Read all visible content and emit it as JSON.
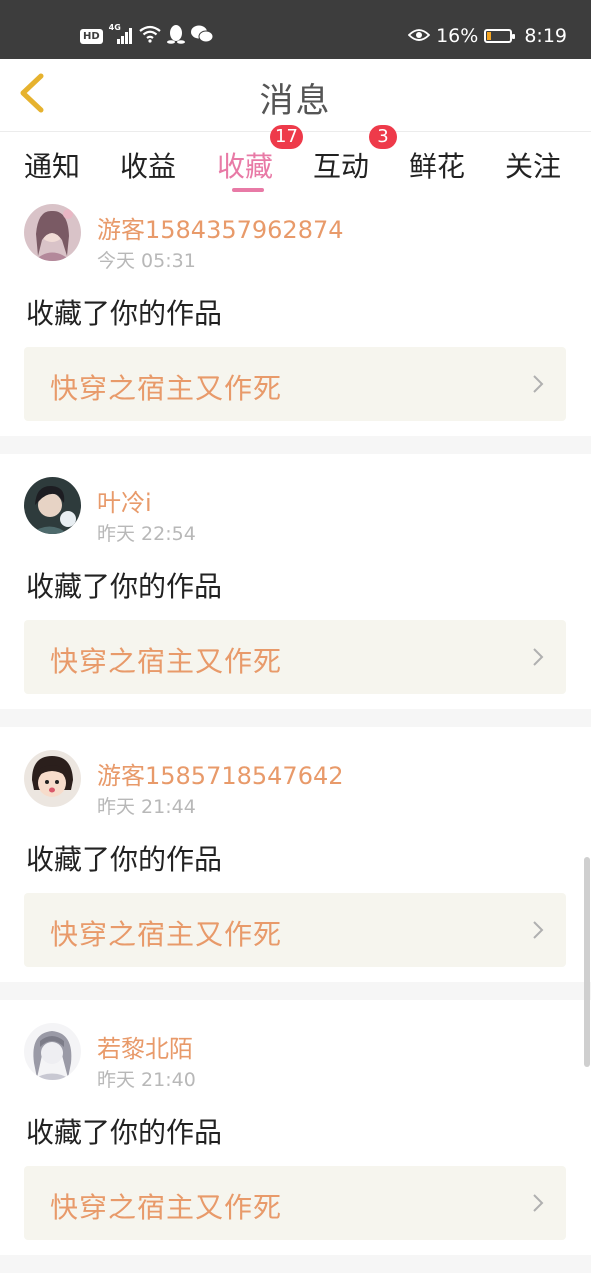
{
  "status_bar": {
    "hd": "HD",
    "network": "4G",
    "battery_percent": "16%",
    "battery_level": 0.16,
    "time": "8:19",
    "icons": [
      "signal-icon",
      "wifi-icon",
      "qq-icon",
      "wechat-icon",
      "eye-icon",
      "battery-icon"
    ]
  },
  "header": {
    "title": "消息",
    "back_icon": "chevron-left-icon",
    "back_color": "#e6b22e"
  },
  "tabs": [
    {
      "label": "通知"
    },
    {
      "label": "收益"
    },
    {
      "label": "收藏",
      "active": true,
      "badge": "17"
    },
    {
      "label": "互动",
      "badge": "3"
    },
    {
      "label": "鲜花"
    },
    {
      "label": "关注"
    }
  ],
  "colors": {
    "accent_pink": "#e87aa6",
    "username_orange": "#e89a6a",
    "badge_red": "#ee3a4a",
    "card_bg": "#f6f5ee"
  },
  "messages": [
    {
      "username": "游客1584357962874",
      "time": "今天 05:31",
      "action": "收藏了你的作品",
      "work": "快穿之宿主又作死"
    },
    {
      "username": "叶冷i",
      "time": "昨天 22:54",
      "action": "收藏了你的作品",
      "work": "快穿之宿主又作死"
    },
    {
      "username": "游客1585718547642",
      "time": "昨天 21:44",
      "action": "收藏了你的作品",
      "work": "快穿之宿主又作死"
    },
    {
      "username": "若黎北陌",
      "time": "昨天 21:40",
      "action": "收藏了你的作品",
      "work": "快穿之宿主又作死"
    }
  ]
}
